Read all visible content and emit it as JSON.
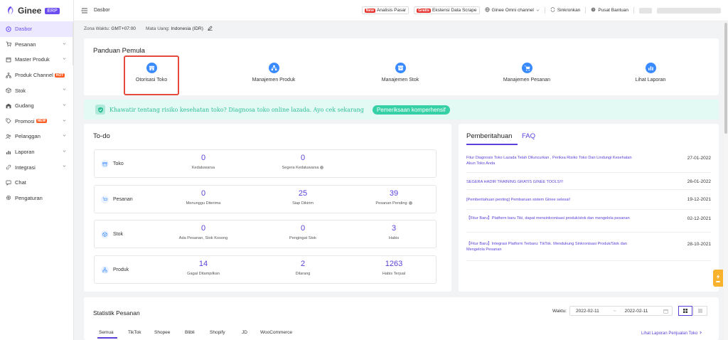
{
  "app": {
    "logo_text": "Ginee",
    "badge": "ERP"
  },
  "topbar": {
    "breadcrumb": "Dasbor",
    "new_tag": "New",
    "analisis_label": "Analisis Pasar",
    "gratis_tag": "Gratis",
    "ekstensi_label": "Ekstensi Data Scrape",
    "omni_label": "Ginee Omni channel",
    "sync_label": "Sinkronkan",
    "help_label": "Pusat Bantuan"
  },
  "sidebar": {
    "items": [
      {
        "label": "Dasbor"
      },
      {
        "label": "Pesanan"
      },
      {
        "label": "Master Produk"
      },
      {
        "label": "Produk Channel",
        "badge": "HOT"
      },
      {
        "label": "Stok"
      },
      {
        "label": "Gudang"
      },
      {
        "label": "Promosi",
        "badge": "NEW"
      },
      {
        "label": "Pelanggan"
      },
      {
        "label": "Laporan"
      },
      {
        "label": "Integrasi"
      },
      {
        "label": "Chat"
      },
      {
        "label": "Pengaturan"
      }
    ]
  },
  "info": {
    "tz_label": "Zona Waktu:",
    "tz_value": "GMT+07:00",
    "cur_label": "Mata Uang:",
    "cur_value": "Indonesia (IDR)"
  },
  "guide": {
    "title": "Panduan Pemula",
    "items": [
      "Otorisasi Toko",
      "Manajemen Produk",
      "Manajemen Stok",
      "Manajemen Pesanan",
      "Lihat Laporan"
    ]
  },
  "banner": {
    "text": "Khawatir tentang risiko kesehatan toko? Diagnosa toko online lazada. Ayo cek sekarang",
    "button": "Pemeriksaan komperhensif"
  },
  "todo": {
    "title": "To-do",
    "rows": [
      {
        "label": "Toko",
        "stats": [
          {
            "n": "0",
            "l": "Kedaluwarsa"
          },
          {
            "n": "0",
            "l": "Segera Kedaluwarsa"
          }
        ]
      },
      {
        "label": "Pesanan",
        "stats": [
          {
            "n": "0",
            "l": "Menunggu Diterima"
          },
          {
            "n": "25",
            "l": "Siap Dikirim"
          },
          {
            "n": "39",
            "l": "Pesanan Pending"
          }
        ]
      },
      {
        "label": "Stok",
        "stats": [
          {
            "n": "0",
            "l": "Ada Pesanan, Stok Kosong"
          },
          {
            "n": "0",
            "l": "Pengingat Stok"
          },
          {
            "n": "3",
            "l": "Habis"
          }
        ]
      },
      {
        "label": "Produk",
        "stats": [
          {
            "n": "14",
            "l": "Gagal Ditampilkan"
          },
          {
            "n": "2",
            "l": "Dilarang"
          },
          {
            "n": "1263",
            "l": "Habis Terjual"
          }
        ]
      }
    ]
  },
  "notif": {
    "tab_active": "Pemberitahuan",
    "tab_other": "FAQ",
    "items": [
      {
        "text": "Fitur Diagnosis Toko Lazada Telah Diluncurkan , Periksa Risiko Toko Dan Lindungi Kesehatan Akun Toko Anda",
        "date": "27-01-2022"
      },
      {
        "text": "SEGERA HADIR TRAINING GRATIS GINEE TOOLS!!!",
        "date": "26-01-2022"
      },
      {
        "text": "[Pemberitahuan penting] Pembaruan sistem Ginee selesai!",
        "date": "19-12-2021"
      },
      {
        "text": "【Fitur Baru】Platform baru Tiki, dapat mensinkronisasi produk/stok dan mengelola pesanan",
        "date": "02-12-2021"
      },
      {
        "text": "【Fitur Baru】Integrasi Platform Terbaru: TikTok. Mendukung Sinkronisasi Produk/Stok dan Mengelola Pesanan",
        "date": "28-10-2021"
      }
    ]
  },
  "stat": {
    "title": "Statistik Pesanan",
    "waktu_label": "Waktu:",
    "date_from": "2022-02-11",
    "date_sep": "~",
    "date_to": "2022-02-11",
    "tabs": [
      "Semua",
      "TikTok",
      "Shopee",
      "Blibli",
      "Shopify",
      "JD",
      "WooCommerce"
    ],
    "report_link": "Lihat Laporan Penjualan Toko"
  },
  "colors": {
    "accent": "#5b3fd8",
    "brand": "#6a4cf0",
    "teal": "#2fbf95",
    "highlight": "#e64a3c"
  }
}
